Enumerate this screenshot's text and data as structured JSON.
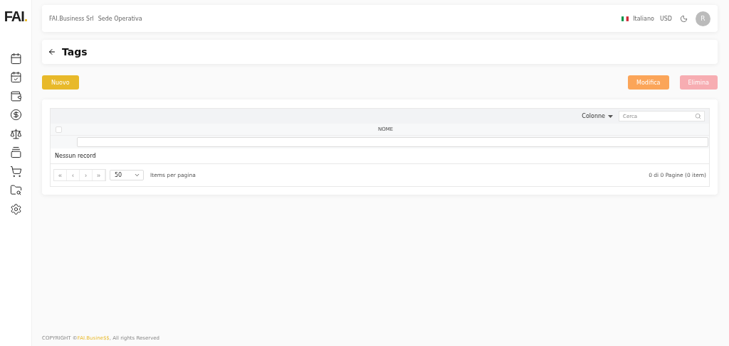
{
  "logo": {
    "text": "FAI",
    "dot": "."
  },
  "header": {
    "company": "FAI.Business Srl",
    "site": "Sede Operativa",
    "language": "Italiano",
    "currency": "USD",
    "avatar": "R"
  },
  "page": {
    "title": "Tags"
  },
  "actions": [
    {
      "label": "Nuovo",
      "kind": "primary",
      "disabled": false
    },
    {
      "label": "Modifica",
      "kind": "edit",
      "disabled": false
    },
    {
      "label": "Elimina",
      "kind": "delete",
      "disabled": true
    }
  ],
  "table": {
    "columns_button": "Colonne",
    "search": {
      "placeholder": "Cerca"
    },
    "select_all": {
      "checked": false
    },
    "columns": [
      "NOME"
    ],
    "empty": "Nessun record",
    "pager": {
      "buttons": [
        {
          "label": "«",
          "disabled": true
        },
        {
          "label": "‹",
          "disabled": true
        },
        {
          "label": "›",
          "disabled": true
        },
        {
          "label": "»",
          "disabled": true
        }
      ],
      "page_size": "50",
      "page_size_label": "Items per pagina",
      "summary": "0 di 0 Pagine (0 item)"
    }
  },
  "footer": {
    "prefix": "COPYRIGHT ©",
    "brand": "FAI.Busine$$",
    "suffix": ", All rights Reserved"
  }
}
